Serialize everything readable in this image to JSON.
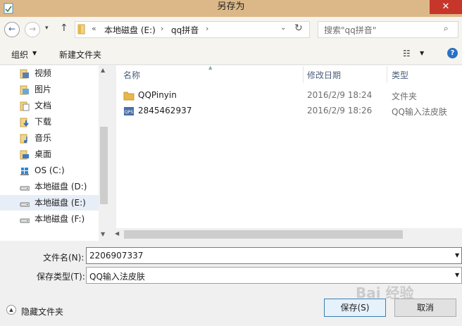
{
  "window": {
    "title": "另存为",
    "close_symbol": "✕"
  },
  "nav": {
    "back_symbol": "←",
    "forward_symbol": "→",
    "recent_symbol": "▾",
    "up_symbol": "↑",
    "address": {
      "overflow": "«",
      "segments": [
        "本地磁盘 (E:)",
        "qq拼音"
      ],
      "separator": "›",
      "dropdown": "⌄"
    },
    "refresh_symbol": "↻",
    "search_placeholder": "搜索\"qq拼音\"",
    "search_symbol": "⌕"
  },
  "toolbar": {
    "organize": "组织",
    "dropdown": "▼",
    "new_folder": "新建文件夹",
    "view_symbol": "☷",
    "help_symbol": "?"
  },
  "sidebar": {
    "items": [
      {
        "label": "视频",
        "icon": "video-library-icon"
      },
      {
        "label": "图片",
        "icon": "pictures-library-icon"
      },
      {
        "label": "文档",
        "icon": "documents-library-icon"
      },
      {
        "label": "下载",
        "icon": "downloads-icon"
      },
      {
        "label": "音乐",
        "icon": "music-library-icon"
      },
      {
        "label": "桌面",
        "icon": "desktop-icon"
      },
      {
        "label": "OS (C:)",
        "icon": "windows-drive-icon"
      },
      {
        "label": "本地磁盘 (D:)",
        "icon": "drive-icon"
      },
      {
        "label": "本地磁盘 (E:)",
        "icon": "drive-icon",
        "selected": true
      },
      {
        "label": "本地磁盘 (F:)",
        "icon": "drive-icon"
      }
    ],
    "scroll_up": "▲",
    "scroll_down": "▼"
  },
  "files": {
    "columns": {
      "name": "名称",
      "date": "修改日期",
      "type": "类型"
    },
    "sort_symbol": "▲",
    "rows": [
      {
        "name": "QQPinyin",
        "date": "2016/2/9 18:24",
        "type": "文件夹",
        "icon": "folder-icon"
      },
      {
        "name": "2845462937",
        "date": "2016/2/9 18:26",
        "type": "QQ输入法皮肤",
        "icon": "skin-file-icon"
      }
    ],
    "hscroll_left": "◀"
  },
  "form": {
    "filename_label": "文件名(N):",
    "filename_value": "2206907337",
    "filetype_label": "保存类型(T):",
    "filetype_value": "QQ输入法皮肤",
    "dropdown": "▼",
    "hide_folders": "隐藏文件夹",
    "hide_symbol": "▲",
    "save": "保存(S)",
    "cancel": "取消"
  },
  "watermark": "Bai 经验",
  "colors": {
    "titlebar": "#dcb888",
    "close": "#c7362b",
    "folder": "#e8b64a",
    "accent": "#2a71c6"
  }
}
